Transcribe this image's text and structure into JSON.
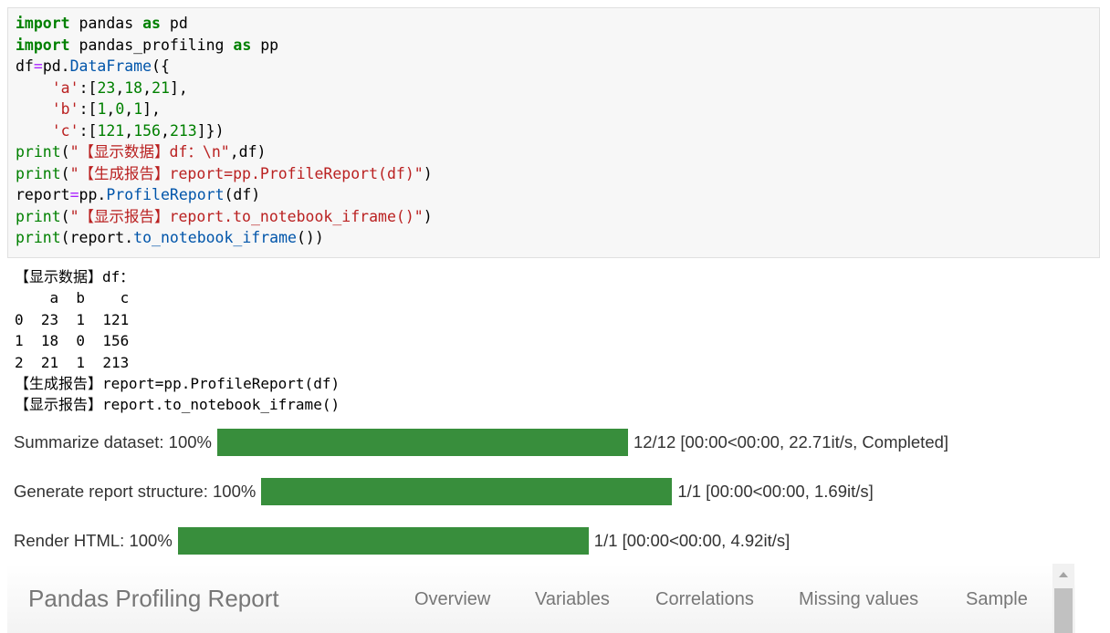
{
  "code_cell": {
    "line1": {
      "kw": "import",
      "mod": " pandas ",
      "as": "as",
      "alias": " pd"
    },
    "line2": {
      "kw": "import",
      "mod": " pandas_profiling ",
      "as": "as",
      "alias": " pp"
    },
    "line3": {
      "a": "df",
      "eq": "=",
      "b": "pd.",
      "fn": "DataFrame",
      "c": "({"
    },
    "line4": {
      "indent": "    ",
      "key": "'a'",
      "a": ":[",
      "n1": "23",
      "s1": ",",
      "n2": "18",
      "s2": ",",
      "n3": "21",
      "end": "],"
    },
    "line5": {
      "indent": "    ",
      "key": "'b'",
      "a": ":[",
      "n1": "1",
      "s1": ",",
      "n2": "0",
      "s2": ",",
      "n3": "1",
      "end": "],"
    },
    "line6": {
      "indent": "    ",
      "key": "'c'",
      "a": ":[",
      "n1": "121",
      "s1": ",",
      "n2": "156",
      "s2": ",",
      "n3": "213",
      "end": "]})"
    },
    "line7": {
      "fn": "print",
      "a": "(",
      "str": "\"【显示数据】df：\\n\"",
      "b": ",df)"
    },
    "line8": {
      "fn": "print",
      "a": "(",
      "str": "\"【生成报告】report=pp.ProfileReport(df)\"",
      "b": ")"
    },
    "line9": {
      "a": "report",
      "eq": "=",
      "b": "pp.",
      "fn": "ProfileReport",
      "c": "(df)"
    },
    "line10": {
      "fn": "print",
      "a": "(",
      "str": "\"【显示报告】report.to_notebook_iframe()\"",
      "b": ")"
    },
    "line11": {
      "fn": "print",
      "a": "(report.",
      "fn2": "to_notebook_iframe",
      "b": "())"
    }
  },
  "output": {
    "lines": [
      "【显示数据】df：",
      "    a  b    c",
      "0  23  1  121",
      "1  18  0  156",
      "2  21  1  213",
      "【生成报告】report=pp.ProfileReport(df)",
      "【显示报告】report.to_notebook_iframe()"
    ]
  },
  "progress": [
    {
      "label": "Summarize dataset: 100%",
      "status": "12/12 [00:00<00:00, 22.71it/s, Completed]",
      "progress_percent": 100
    },
    {
      "label": "Generate report structure: 100%",
      "status": "1/1 [00:00<00:00, 1.69it/s]",
      "progress_percent": 100
    },
    {
      "label": "Render HTML: 100%",
      "status": "1/1 [00:00<00:00, 4.92it/s]",
      "progress_percent": 100
    }
  ],
  "report": {
    "title": "Pandas Profiling Report",
    "nav": [
      "Overview",
      "Variables",
      "Correlations",
      "Missing values",
      "Sample"
    ]
  },
  "colors": {
    "progress_bar": "#388e3c",
    "keyword": "#008000",
    "string": "#ba2121",
    "function": "#0055aa",
    "operator": "#aa22ff"
  },
  "icons": {
    "scroll_up": "triangle-up"
  }
}
